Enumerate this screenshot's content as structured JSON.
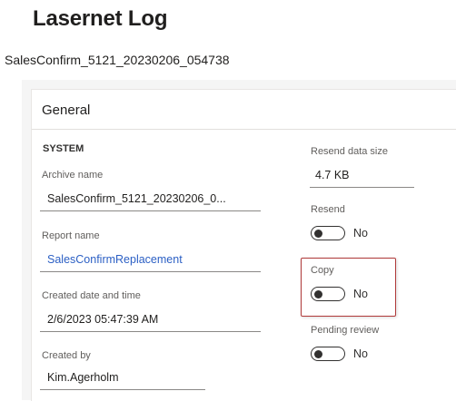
{
  "page": {
    "title": "Lasernet Log",
    "record": "SalesConfirm_5121_20230206_054738"
  },
  "card": {
    "header": "General",
    "section": "SYSTEM"
  },
  "fields": {
    "archive_name": {
      "label": "Archive name",
      "value": "SalesConfirm_5121_20230206_0..."
    },
    "report_name": {
      "label": "Report name",
      "value": "SalesConfirmReplacement"
    },
    "created_datetime": {
      "label": "Created date and time",
      "value": "2/6/2023 05:47:39 AM"
    },
    "created_by": {
      "label": "Created by",
      "value": "Kim.Agerholm"
    },
    "resend_size": {
      "label": "Resend data size",
      "value": "4.7 KB"
    }
  },
  "toggles": {
    "resend": {
      "label": "Resend",
      "state": "No"
    },
    "copy": {
      "label": "Copy",
      "state": "No"
    },
    "pending_review": {
      "label": "Pending review",
      "state": "No"
    }
  },
  "colors": {
    "link": "#2b5fc4",
    "highlight": "#b03a3a"
  }
}
